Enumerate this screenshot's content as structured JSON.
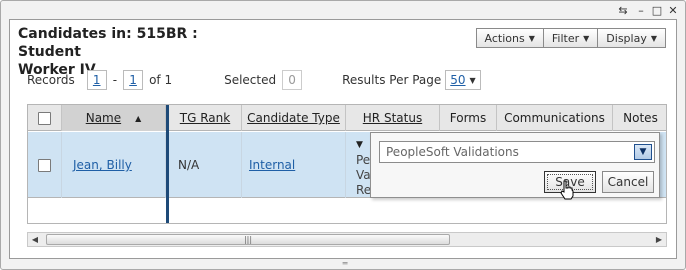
{
  "window": {
    "title_line1": "Candidates in: 515BR : Student",
    "title_line2": "Worker IV",
    "controls": [
      "restore-icon",
      "minimize-icon",
      "maximize-icon",
      "close-icon"
    ]
  },
  "menus": {
    "actions": "Actions",
    "filter": "Filter",
    "display": "Display"
  },
  "paging": {
    "records_label": "Records",
    "from": "1",
    "dash": "-",
    "to": "1",
    "of_text": "of 1",
    "selected_label": "Selected",
    "selected_count": "0",
    "rpp_label": "Results Per Page",
    "rpp_value": "50"
  },
  "table": {
    "columns": [
      "Name",
      "TG Rank",
      "Candidate Type",
      "HR Status",
      "Forms",
      "Communications",
      "Notes"
    ],
    "rows": [
      {
        "name": "Jean, Billy",
        "tg_rank": "N/A",
        "candidate_type": "Internal",
        "hr_status_lines": [
          "Pe",
          "Va",
          "Re"
        ]
      }
    ]
  },
  "popup": {
    "dropdown_value": "PeopleSoft Validations",
    "save_label": "Save",
    "cancel_label": "Cancel"
  },
  "colors": {
    "accent_link": "#1f5fa6",
    "row_selected": "#cfe3f3",
    "frozen_divider": "#1e4a78"
  }
}
